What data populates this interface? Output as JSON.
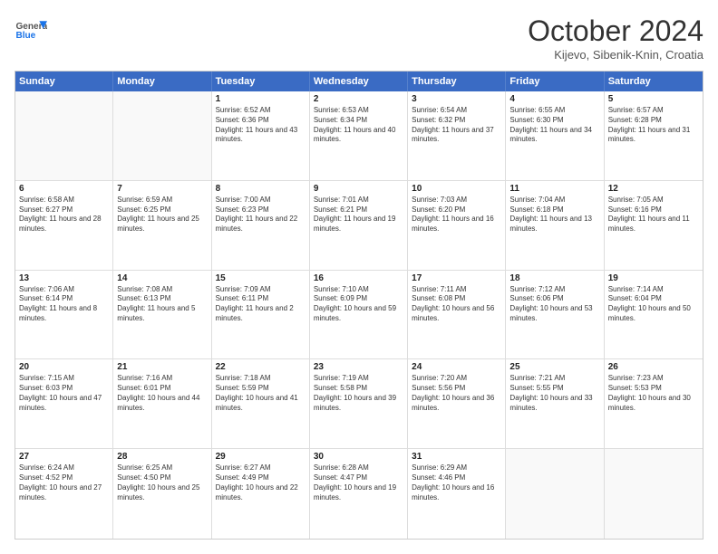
{
  "header": {
    "logo_general": "General",
    "logo_blue": "Blue",
    "month_title": "October 2024",
    "location": "Kijevo, Sibenik-Knin, Croatia"
  },
  "days_of_week": [
    "Sunday",
    "Monday",
    "Tuesday",
    "Wednesday",
    "Thursday",
    "Friday",
    "Saturday"
  ],
  "weeks": [
    [
      {
        "day": "",
        "sunrise": "",
        "sunset": "",
        "daylight": "",
        "empty": true
      },
      {
        "day": "",
        "sunrise": "",
        "sunset": "",
        "daylight": "",
        "empty": true
      },
      {
        "day": "1",
        "sunrise": "Sunrise: 6:52 AM",
        "sunset": "Sunset: 6:36 PM",
        "daylight": "Daylight: 11 hours and 43 minutes."
      },
      {
        "day": "2",
        "sunrise": "Sunrise: 6:53 AM",
        "sunset": "Sunset: 6:34 PM",
        "daylight": "Daylight: 11 hours and 40 minutes."
      },
      {
        "day": "3",
        "sunrise": "Sunrise: 6:54 AM",
        "sunset": "Sunset: 6:32 PM",
        "daylight": "Daylight: 11 hours and 37 minutes."
      },
      {
        "day": "4",
        "sunrise": "Sunrise: 6:55 AM",
        "sunset": "Sunset: 6:30 PM",
        "daylight": "Daylight: 11 hours and 34 minutes."
      },
      {
        "day": "5",
        "sunrise": "Sunrise: 6:57 AM",
        "sunset": "Sunset: 6:28 PM",
        "daylight": "Daylight: 11 hours and 31 minutes."
      }
    ],
    [
      {
        "day": "6",
        "sunrise": "Sunrise: 6:58 AM",
        "sunset": "Sunset: 6:27 PM",
        "daylight": "Daylight: 11 hours and 28 minutes."
      },
      {
        "day": "7",
        "sunrise": "Sunrise: 6:59 AM",
        "sunset": "Sunset: 6:25 PM",
        "daylight": "Daylight: 11 hours and 25 minutes."
      },
      {
        "day": "8",
        "sunrise": "Sunrise: 7:00 AM",
        "sunset": "Sunset: 6:23 PM",
        "daylight": "Daylight: 11 hours and 22 minutes."
      },
      {
        "day": "9",
        "sunrise": "Sunrise: 7:01 AM",
        "sunset": "Sunset: 6:21 PM",
        "daylight": "Daylight: 11 hours and 19 minutes."
      },
      {
        "day": "10",
        "sunrise": "Sunrise: 7:03 AM",
        "sunset": "Sunset: 6:20 PM",
        "daylight": "Daylight: 11 hours and 16 minutes."
      },
      {
        "day": "11",
        "sunrise": "Sunrise: 7:04 AM",
        "sunset": "Sunset: 6:18 PM",
        "daylight": "Daylight: 11 hours and 13 minutes."
      },
      {
        "day": "12",
        "sunrise": "Sunrise: 7:05 AM",
        "sunset": "Sunset: 6:16 PM",
        "daylight": "Daylight: 11 hours and 11 minutes."
      }
    ],
    [
      {
        "day": "13",
        "sunrise": "Sunrise: 7:06 AM",
        "sunset": "Sunset: 6:14 PM",
        "daylight": "Daylight: 11 hours and 8 minutes."
      },
      {
        "day": "14",
        "sunrise": "Sunrise: 7:08 AM",
        "sunset": "Sunset: 6:13 PM",
        "daylight": "Daylight: 11 hours and 5 minutes."
      },
      {
        "day": "15",
        "sunrise": "Sunrise: 7:09 AM",
        "sunset": "Sunset: 6:11 PM",
        "daylight": "Daylight: 11 hours and 2 minutes."
      },
      {
        "day": "16",
        "sunrise": "Sunrise: 7:10 AM",
        "sunset": "Sunset: 6:09 PM",
        "daylight": "Daylight: 10 hours and 59 minutes."
      },
      {
        "day": "17",
        "sunrise": "Sunrise: 7:11 AM",
        "sunset": "Sunset: 6:08 PM",
        "daylight": "Daylight: 10 hours and 56 minutes."
      },
      {
        "day": "18",
        "sunrise": "Sunrise: 7:12 AM",
        "sunset": "Sunset: 6:06 PM",
        "daylight": "Daylight: 10 hours and 53 minutes."
      },
      {
        "day": "19",
        "sunrise": "Sunrise: 7:14 AM",
        "sunset": "Sunset: 6:04 PM",
        "daylight": "Daylight: 10 hours and 50 minutes."
      }
    ],
    [
      {
        "day": "20",
        "sunrise": "Sunrise: 7:15 AM",
        "sunset": "Sunset: 6:03 PM",
        "daylight": "Daylight: 10 hours and 47 minutes."
      },
      {
        "day": "21",
        "sunrise": "Sunrise: 7:16 AM",
        "sunset": "Sunset: 6:01 PM",
        "daylight": "Daylight: 10 hours and 44 minutes."
      },
      {
        "day": "22",
        "sunrise": "Sunrise: 7:18 AM",
        "sunset": "Sunset: 5:59 PM",
        "daylight": "Daylight: 10 hours and 41 minutes."
      },
      {
        "day": "23",
        "sunrise": "Sunrise: 7:19 AM",
        "sunset": "Sunset: 5:58 PM",
        "daylight": "Daylight: 10 hours and 39 minutes."
      },
      {
        "day": "24",
        "sunrise": "Sunrise: 7:20 AM",
        "sunset": "Sunset: 5:56 PM",
        "daylight": "Daylight: 10 hours and 36 minutes."
      },
      {
        "day": "25",
        "sunrise": "Sunrise: 7:21 AM",
        "sunset": "Sunset: 5:55 PM",
        "daylight": "Daylight: 10 hours and 33 minutes."
      },
      {
        "day": "26",
        "sunrise": "Sunrise: 7:23 AM",
        "sunset": "Sunset: 5:53 PM",
        "daylight": "Daylight: 10 hours and 30 minutes."
      }
    ],
    [
      {
        "day": "27",
        "sunrise": "Sunrise: 6:24 AM",
        "sunset": "Sunset: 4:52 PM",
        "daylight": "Daylight: 10 hours and 27 minutes."
      },
      {
        "day": "28",
        "sunrise": "Sunrise: 6:25 AM",
        "sunset": "Sunset: 4:50 PM",
        "daylight": "Daylight: 10 hours and 25 minutes."
      },
      {
        "day": "29",
        "sunrise": "Sunrise: 6:27 AM",
        "sunset": "Sunset: 4:49 PM",
        "daylight": "Daylight: 10 hours and 22 minutes."
      },
      {
        "day": "30",
        "sunrise": "Sunrise: 6:28 AM",
        "sunset": "Sunset: 4:47 PM",
        "daylight": "Daylight: 10 hours and 19 minutes."
      },
      {
        "day": "31",
        "sunrise": "Sunrise: 6:29 AM",
        "sunset": "Sunset: 4:46 PM",
        "daylight": "Daylight: 10 hours and 16 minutes."
      },
      {
        "day": "",
        "sunrise": "",
        "sunset": "",
        "daylight": "",
        "empty": true
      },
      {
        "day": "",
        "sunrise": "",
        "sunset": "",
        "daylight": "",
        "empty": true
      }
    ]
  ]
}
